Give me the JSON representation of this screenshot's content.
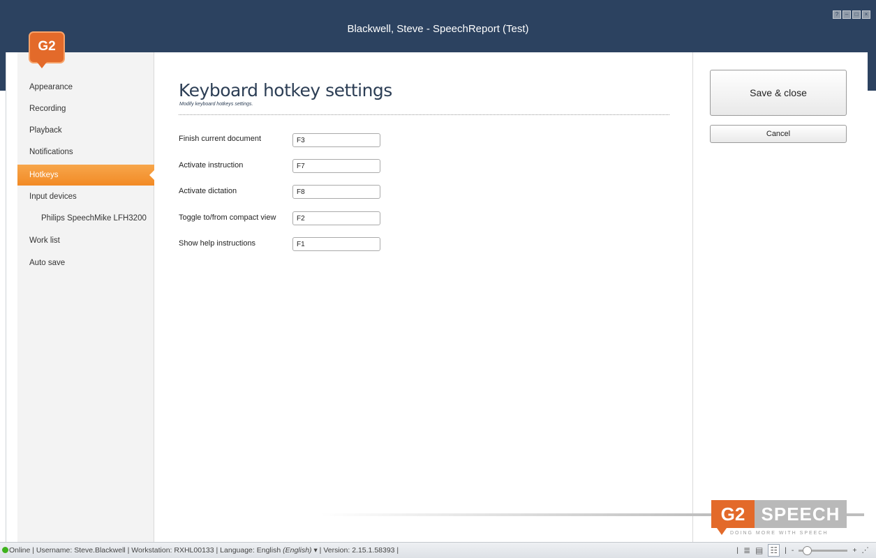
{
  "window": {
    "title": "Blackwell, Steve - SpeechReport (Test)",
    "logo_text": "G2",
    "controls": [
      "?",
      "–",
      "□",
      "×"
    ]
  },
  "sidebar": {
    "items": [
      {
        "label": "Appearance"
      },
      {
        "label": "Recording"
      },
      {
        "label": "Playback"
      },
      {
        "label": "Notifications"
      },
      {
        "label": "Hotkeys",
        "active": true
      },
      {
        "label": "Input devices"
      },
      {
        "label": "Philips SpeechMike LFH3200",
        "sub": true
      },
      {
        "label": "Work list"
      },
      {
        "label": "Auto save"
      }
    ]
  },
  "main": {
    "title": "Keyboard hotkey settings",
    "subtitle": "Modify keyboard hotkeys settings.",
    "hotkeys": [
      {
        "label": "Finish current document",
        "value": "F3"
      },
      {
        "label": "Activate instruction",
        "value": "F7"
      },
      {
        "label": "Activate dictation",
        "value": "F8"
      },
      {
        "label": "Toggle to/from compact view",
        "value": "F2"
      },
      {
        "label": "Show help instructions",
        "value": "F1"
      }
    ]
  },
  "actions": {
    "save_label": "Save & close",
    "cancel_label": "Cancel"
  },
  "brand": {
    "g2": "G2",
    "speech": "SPEECH",
    "tagline": "DOING MORE WITH SPEECH"
  },
  "status": {
    "online": "Online",
    "username_label": "Username:",
    "username": "Steve.Blackwell",
    "workstation_label": "Workstation:",
    "workstation": "RXHL00133",
    "language_label": "Language:",
    "language": "English",
    "language_native": "(English)",
    "version_label": "Version:",
    "version": "2.15.1.58393",
    "online_color": "#3fb21d"
  },
  "colors": {
    "titlebar": "#2c4260",
    "accent": "#f28a25",
    "brand_orange": "#e36a2a"
  }
}
